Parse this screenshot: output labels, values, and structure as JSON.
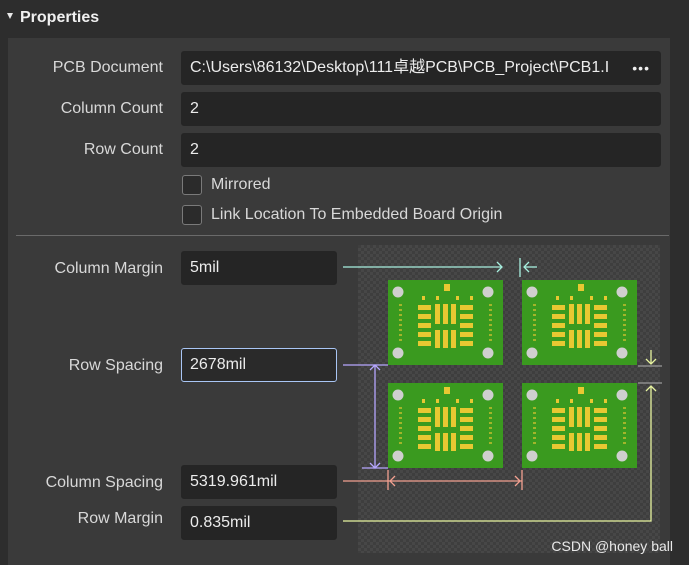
{
  "panel": {
    "title": "Properties"
  },
  "fields": {
    "pcb_document": {
      "label": "PCB Document",
      "value": "C:\\Users\\86132\\Desktop\\111卓越PCB\\PCB_Project\\PCB1.I",
      "more": "•••"
    },
    "column_count": {
      "label": "Column Count",
      "value": "2"
    },
    "row_count": {
      "label": "Row Count",
      "value": "2"
    },
    "column_margin": {
      "label": "Column Margin",
      "value": "5mil"
    },
    "row_spacing": {
      "label": "Row Spacing",
      "value": "2678mil"
    },
    "column_spacing": {
      "label": "Column Spacing",
      "value": "5319.961mil"
    },
    "row_margin": {
      "label": "Row Margin",
      "value": "0.835mil"
    }
  },
  "checkboxes": {
    "mirrored": {
      "label": "Mirrored",
      "checked": false
    },
    "link_location": {
      "label": "Link Location To Embedded Board Origin",
      "checked": false
    }
  },
  "colors": {
    "board": "#3a9a1f",
    "pad": "#e8c832",
    "hole": "#cfcfcf",
    "column_margin_arrow": "#a8f0e0",
    "row_spacing_arrow": "#b6a6ff",
    "column_spacing_arrow": "#f2a090",
    "row_margin_arrow": "#e8f5a0"
  },
  "watermark": "CSDN @honey ball"
}
